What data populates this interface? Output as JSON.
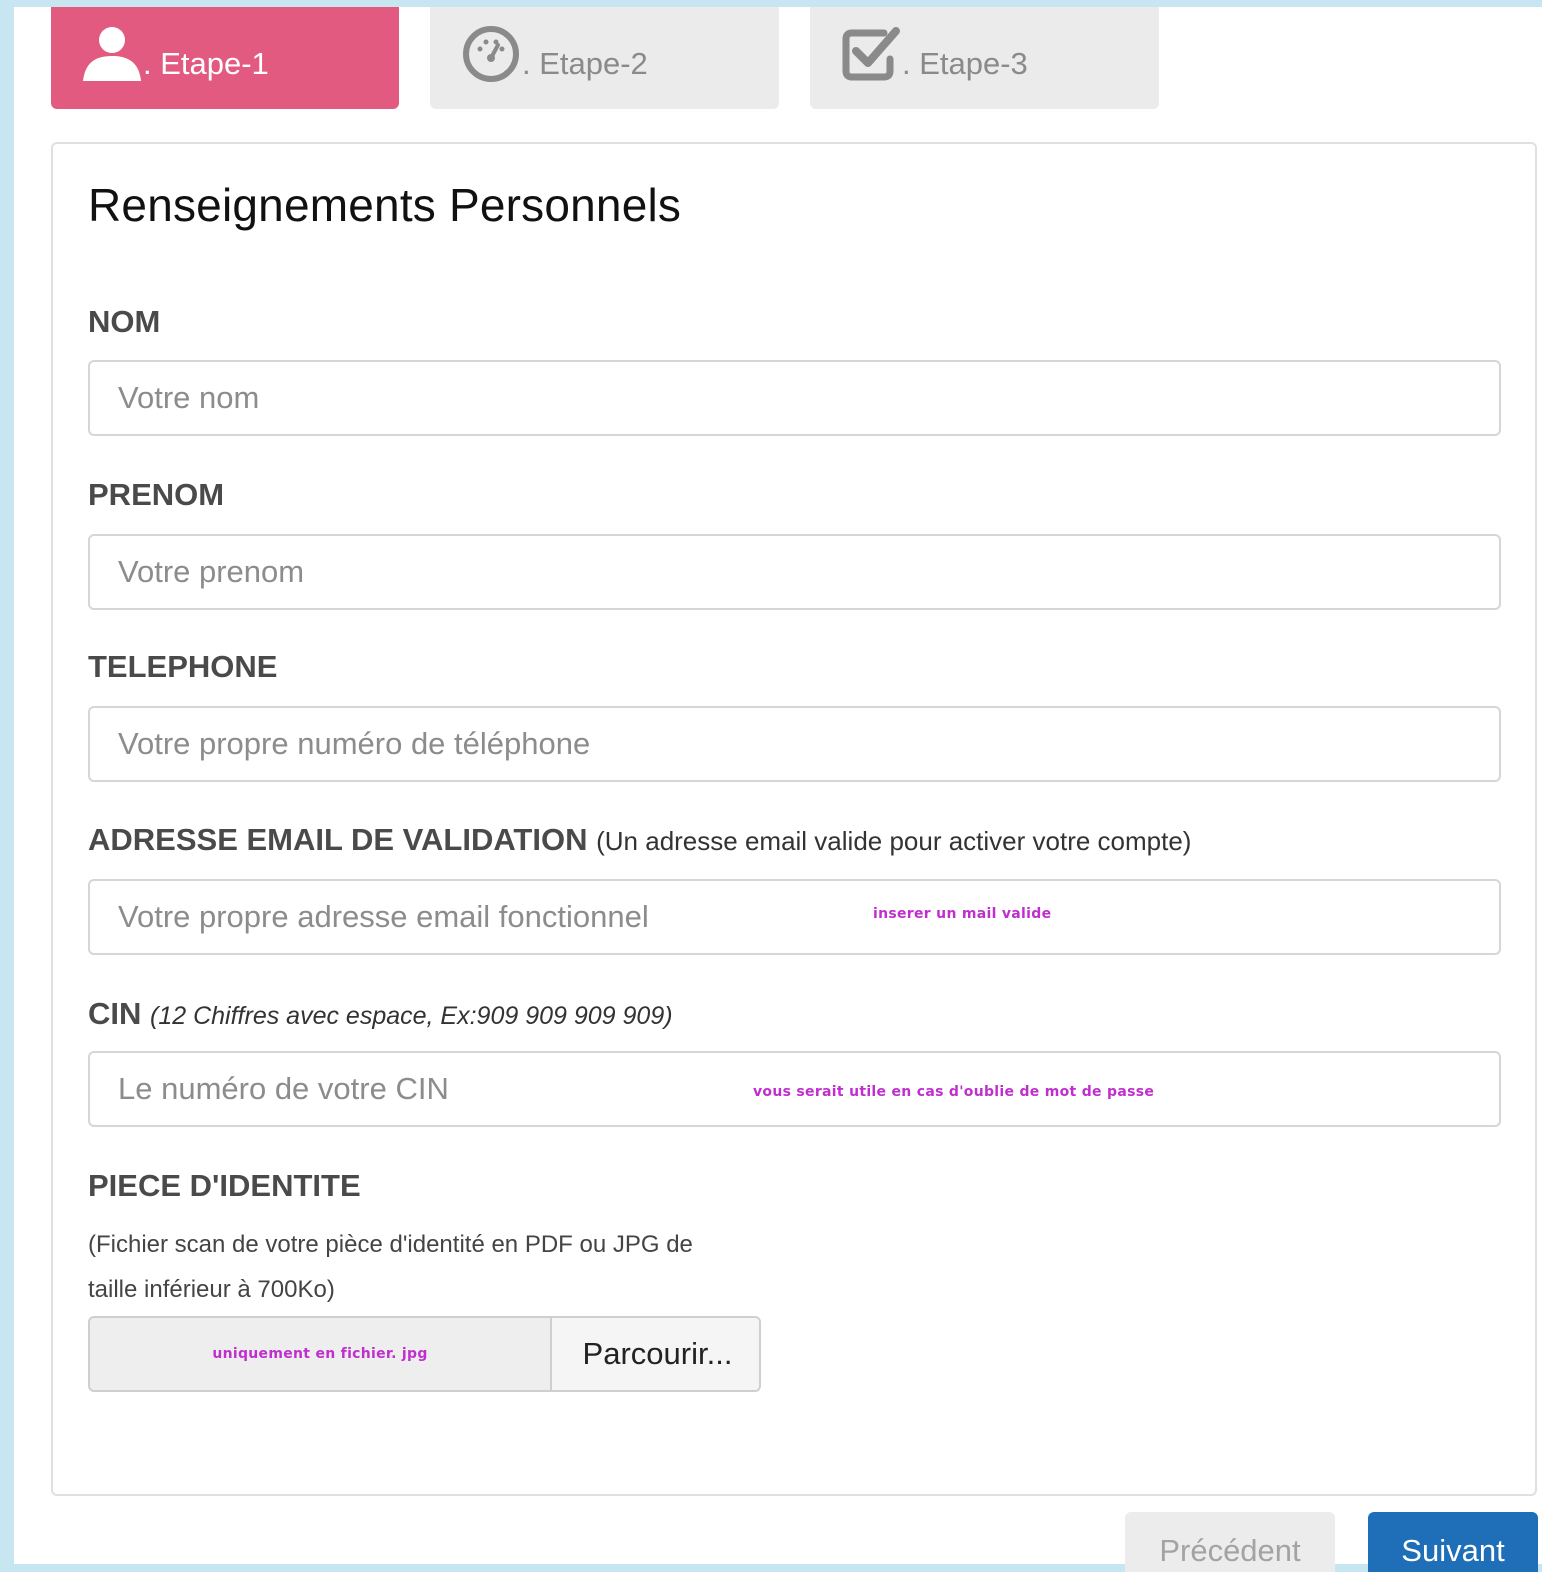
{
  "tabs": [
    {
      "icon": "user-icon",
      "label": ". Etape-1",
      "active": true
    },
    {
      "icon": "dashboard-gauge-icon",
      "label": ". Etape-2",
      "active": false
    },
    {
      "icon": "check-square-icon",
      "label": ". Etape-3",
      "active": false
    }
  ],
  "colors": {
    "active_tab": "#e25a80",
    "inactive_tab": "#ebebeb",
    "primary_button": "#1f6fb8",
    "note_text": "#c12ecf",
    "page_border": "#c8e6f2"
  },
  "form": {
    "title": "Renseignements Personnels",
    "nom": {
      "label": "NOM",
      "placeholder": "Votre nom",
      "value": ""
    },
    "prenom": {
      "label": "PRENOM",
      "placeholder": "Votre prenom",
      "value": ""
    },
    "telephone": {
      "label": "TELEPHONE",
      "placeholder": "Votre propre numéro de téléphone",
      "value": ""
    },
    "email": {
      "label": "ADRESSE EMAIL DE VALIDATION",
      "hint": "(Un adresse email valide pour activer votre compte)",
      "placeholder": "Votre propre adresse email fonctionnel",
      "value": "",
      "note": "inserer un mail valide"
    },
    "cin": {
      "label": "CIN",
      "hint": "(12 Chiffres avec espace, Ex:909 909 909 909)",
      "placeholder": "Le numéro de votre CIN",
      "value": "",
      "note": "vous serait utile en cas d'oublie de mot de passe"
    },
    "piece": {
      "label": "PIECE D'IDENTITE",
      "description_line1": "(Fichier scan de votre pièce d'identité en PDF ou JPG de",
      "description_line2": "taille inférieur à 700Ko)",
      "file_note": "uniquement en fichier. jpg",
      "browse_label": "Parcourir..."
    }
  },
  "nav": {
    "prev_label": "Précédent",
    "next_label": "Suivant"
  }
}
